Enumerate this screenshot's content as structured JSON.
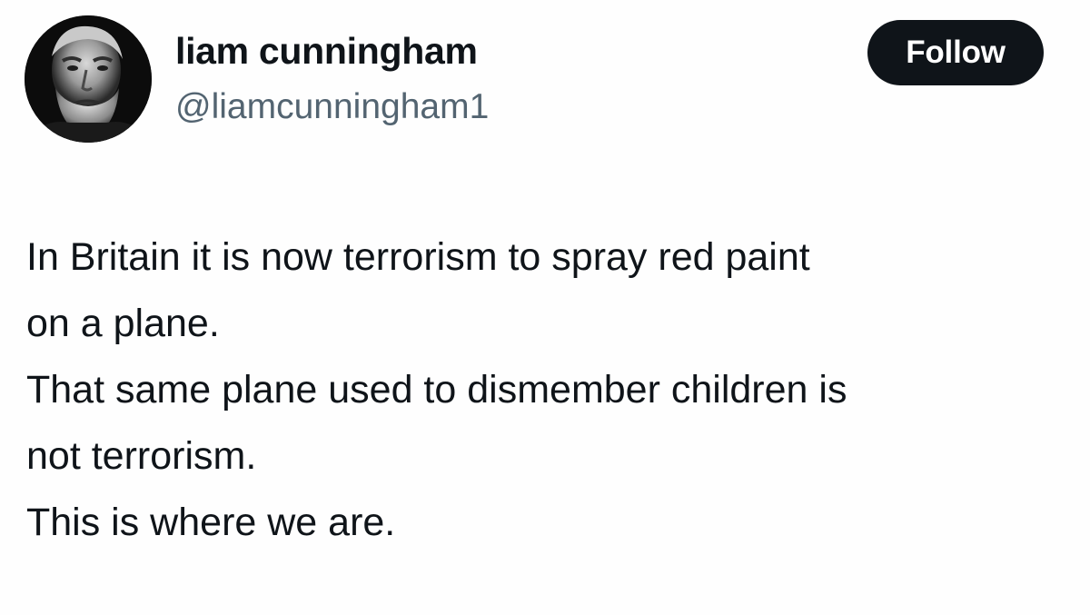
{
  "author": {
    "display_name": "liam cunningham",
    "handle": "@liamcunningham1",
    "avatar_icon": "profile-photo"
  },
  "follow_button": {
    "label": "Follow",
    "background": "#0f1419",
    "text_color": "#ffffff"
  },
  "tweet": {
    "lines": [
      "In Britain it is now terrorism to spray red paint",
      "on a plane.",
      "That same plane used to dismember children is",
      "not terrorism.",
      "This is where we are."
    ]
  },
  "colors": {
    "text_primary": "#0f1419",
    "text_secondary": "#536471",
    "background": "#fefefe"
  }
}
